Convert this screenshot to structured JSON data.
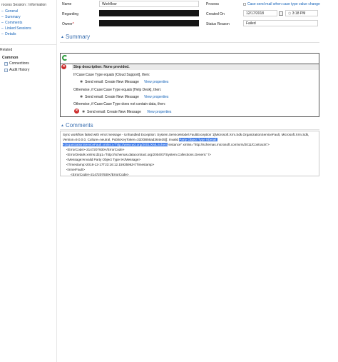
{
  "nav": {
    "header": "rocess Session : Information",
    "links": [
      "General",
      "Summary",
      "Comments",
      "Linked Sessions",
      "Details"
    ],
    "related_label": "Related",
    "common_label": "Common",
    "common_items": [
      "Connections",
      "Audit History"
    ]
  },
  "form": {
    "name_label": "Name",
    "name_value": "Workflow",
    "regarding_label": "Regarding",
    "owner_label": "Owner",
    "owner_required": "*",
    "process_label": "Process",
    "process_value": "Case send mail when case type value change",
    "created_on_label": "Created On",
    "created_date": "12/17/2018",
    "created_time": "3:18 PM",
    "status_reason_label": "Status Reason",
    "status_reason_value": "Failed"
  },
  "summary": {
    "title": "Summary",
    "step_description": "Step description: None provided.",
    "lines": [
      "If Case:Case Type equals [Cloud Support], then:",
      "Send email:  Create New Message",
      "Otherwise, if Case:Case Type equals [Help Desk], then:",
      "Send email:  Create New Message",
      "Otherwise, if Case:Case Type does not contain data, then:",
      "Send email:  Create New Message"
    ],
    "view_properties": "View properties"
  },
  "comments": {
    "title": "Comments",
    "lines": [
      "Sync workflow failed with error:message - Unhandled Exception: System.ServiceModel.FaultException`1[Microsoft.Xrm.Sdk.OrganizationServiceFault, Microsoft.Xrm.Sdk,",
      "Version=9.0.0.0, Culture=neutral, PublicKeyToken=31bf3856ad364e35]]: Invalid ",
      "<OrganizationServiceFault xmlns:i=\"http://www.w3.org/2001/XMLSchem",
      "<ErrorCode>-2147207930</ErrorCode>",
      "<ErrorDetails xmlns:d2p1=\"http://schemas.datacontract.org/2004/07/System.Collections.Generic\" />",
      "<Message>Invalid Party Object Type 9</Message>",
      "<Timestamp>2018-12-17T23:16:12.1593596Z</Timestamp>",
      "<InnerFault>",
      "<ErrorCode>-2147207930</ErrorCode>"
    ],
    "highlight_a": "Party Object Type 9Detail:",
    "line2_tail": "-instance\" xmlns=\"http://schemas.microsoft.com/xrm/2011/Contracts\">"
  },
  "colors": {
    "accent": "#1160b7",
    "section_title": "#3a6fb0",
    "error": "#cc2b2b",
    "highlight": "#3b78e7"
  }
}
